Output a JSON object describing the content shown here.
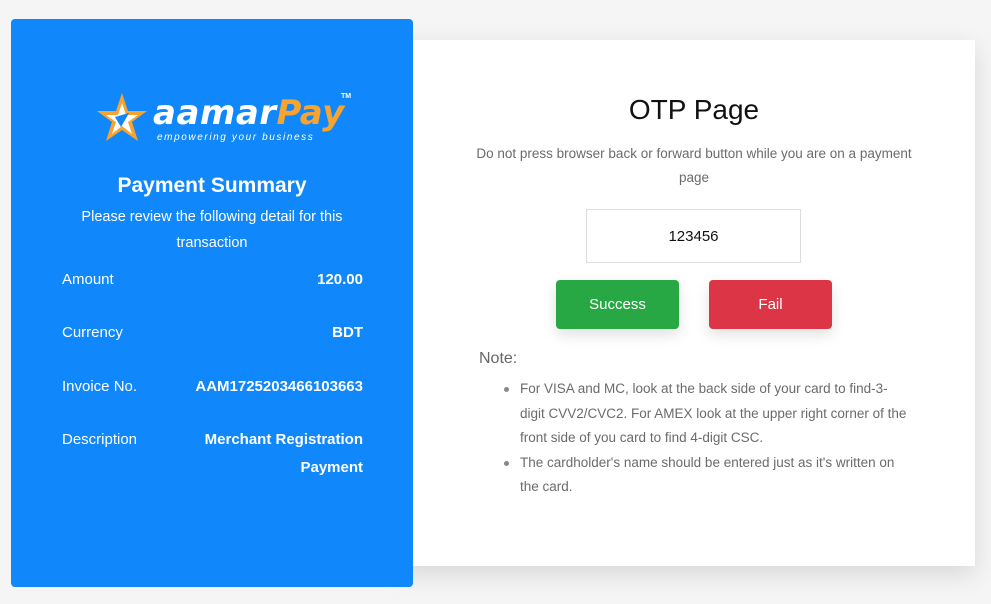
{
  "colors": {
    "panel_blue": "#1087fa",
    "brand_orange": "#f7a32f",
    "success_green": "#28a745",
    "fail_red": "#dc3545"
  },
  "brand": {
    "name_part1": "aamar",
    "name_part2": "Pay",
    "trademark": "TM",
    "tagline": "empowering your business",
    "icon": "star-logo-icon"
  },
  "summary": {
    "title": "Payment Summary",
    "subtitle": "Please review the following detail for this transaction",
    "rows": [
      {
        "label": "Amount",
        "value": "120.00"
      },
      {
        "label": "Currency",
        "value": "BDT"
      },
      {
        "label": "Invoice No.",
        "value": "AAM1725203466103663"
      },
      {
        "label": "Description",
        "value": "Merchant Registration Payment"
      }
    ]
  },
  "otp": {
    "title": "OTP Page",
    "warning": "Do not press browser back or forward button while you are on a payment page",
    "input_value": "123456",
    "success_label": "Success",
    "fail_label": "Fail",
    "note_label": "Note:",
    "notes": [
      "For VISA and MC, look at the back side of your card to find-3-digit CVV2/CVC2. For AMEX look at the upper right corner of the front side of you card to find 4-digit CSC.",
      "The cardholder's name should be entered just as it's written on the card."
    ]
  }
}
